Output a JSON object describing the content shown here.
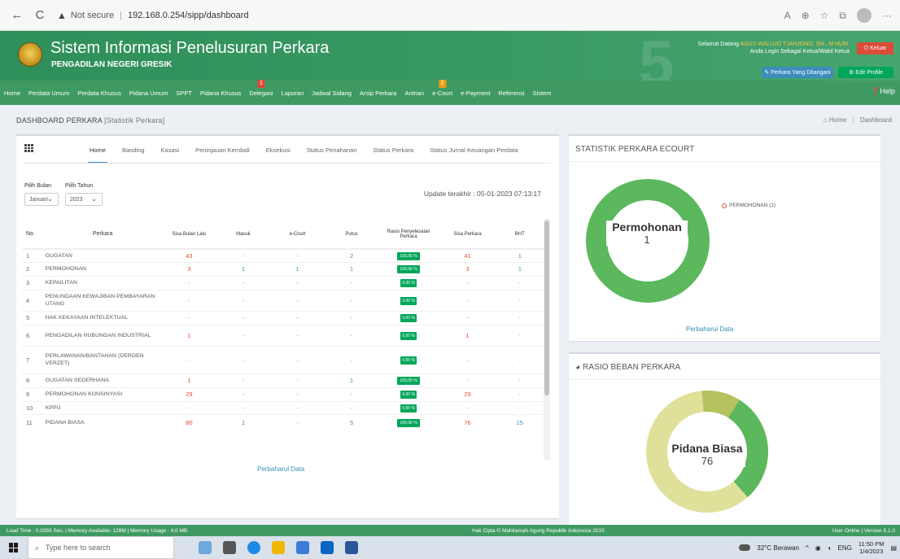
{
  "browser": {
    "back": "←",
    "reload": "C",
    "warning": "▲",
    "not_secure": "Not secure",
    "url": "192.168.0.254/sipp/dashboard"
  },
  "header": {
    "title": "Sistem Informasi Penelusuran Perkara",
    "subtitle": "PENGADILAN NEGERI GRESIK",
    "bg_number": "5",
    "welcome_prefix": "Selamat Datang",
    "welcome_name": "AGUS WALUJO TJAHJONO, SH., M.HUM.",
    "welcome_line2": "Anda Login Sebagai Ketua/Wakil Ketua",
    "keluar": "Keluar",
    "perkara_ditangani": "Perkara Yang Ditangani",
    "edit_profile": "Edit Profile"
  },
  "nav": {
    "items": [
      "Home",
      "Perdata Umum",
      "Perdata Khusus",
      "Pidana Umum",
      "SPPT",
      "Pidana Khusus",
      "Delegasi",
      "Laporan",
      "Jadwal Sidang",
      "Arsip Perkara",
      "Antrian",
      "e-Court",
      "e-Payment",
      "Referensi",
      "Sistem"
    ],
    "delegasi_badge": "1",
    "ecourt_badge": "2",
    "help": "Help"
  },
  "page": {
    "title": "DASHBOARD PERKARA",
    "title_small": "[Statistik Perkara]",
    "breadcrumb_home": "Home",
    "breadcrumb_current": "Dashboard"
  },
  "left_panel": {
    "tabs": [
      "Home",
      "Banding",
      "Kasasi",
      "Peninjauan Kembali",
      "Eksekusi",
      "Status Penahanan",
      "Status Perkara",
      "Status Jurnal Keuangan Perdata"
    ],
    "filter_month_label": "Pilih Bulan",
    "filter_month_value": "Januari",
    "filter_year_label": "Pilih Tahun",
    "filter_year_value": "2023",
    "update_text": "Update terakhir : 05-01-2023 07:13:17",
    "table_headers": {
      "no": "No",
      "perkara": "Perkara",
      "sisa_bulan_lalu": "Sisa Bulan Lalu",
      "masuk": "Masuk",
      "ecourt": "e-Court",
      "putus": "Putus",
      "rasio": "Rasio Penyelesaian Perkara",
      "sisa_perkara": "Sisa Perkara",
      "bht": "BHT"
    },
    "rows": [
      {
        "no": "1",
        "perkara": "GUGATAN",
        "sisa": "43",
        "masuk": "-",
        "ecourt": "-",
        "putus": "2",
        "rasio": "100,00 %",
        "sisa_perkara": "41",
        "bht": "1"
      },
      {
        "no": "2",
        "perkara": "PERMOHONAN",
        "sisa": "3",
        "masuk": "1",
        "ecourt": "1",
        "putus": "1",
        "rasio": "100,00 %",
        "sisa_perkara": "3",
        "bht": "1"
      },
      {
        "no": "3",
        "perkara": "KEPAILITAN",
        "sisa": "-",
        "masuk": "-",
        "ecourt": "-",
        "putus": "-",
        "rasio": "0,00 %",
        "sisa_perkara": "-",
        "bht": "-"
      },
      {
        "no": "4",
        "perkara": "PENUNDAAN KEWAJIBAN PEMBAYARAN UTANG",
        "sisa": "-",
        "masuk": "-",
        "ecourt": "-",
        "putus": "-",
        "rasio": "0,00 %",
        "sisa_perkara": "-",
        "bht": "-"
      },
      {
        "no": "5",
        "perkara": "HAK KEKAYAAN INTELEKTUAL",
        "sisa": "-",
        "masuk": "-",
        "ecourt": "-",
        "putus": "-",
        "rasio": "0,00 %",
        "sisa_perkara": "-",
        "bht": "-"
      },
      {
        "no": "6",
        "perkara": "PENGADILAN HUBUNGAN INDUSTRIAL",
        "sisa": "1",
        "masuk": "-",
        "ecourt": "-",
        "putus": "-",
        "rasio": "0,00 %",
        "sisa_perkara": "1",
        "bht": "-"
      },
      {
        "no": "7",
        "perkara": "PERLAWANAN/BANTAHAN (DERDEN VERZET)",
        "sisa": "-",
        "masuk": "-",
        "ecourt": "-",
        "putus": "-",
        "rasio": "0,00 %",
        "sisa_perkara": "-",
        "bht": "-"
      },
      {
        "no": "8",
        "perkara": "GUGATAN SEDERHANA",
        "sisa": "1",
        "masuk": "-",
        "ecourt": "-",
        "putus": "1",
        "rasio": "100,00 %",
        "sisa_perkara": "-",
        "bht": "-"
      },
      {
        "no": "9",
        "perkara": "PERMOHONAN KONSINYASI",
        "sisa": "29",
        "masuk": "-",
        "ecourt": "-",
        "putus": "-",
        "rasio": "0,00 %",
        "sisa_perkara": "29",
        "bht": "-"
      },
      {
        "no": "10",
        "perkara": "KPPU",
        "sisa": "-",
        "masuk": "-",
        "ecourt": "-",
        "putus": "-",
        "rasio": "0,00 %",
        "sisa_perkara": "-",
        "bht": "-"
      },
      {
        "no": "11",
        "perkara": "PIDANA BIASA",
        "sisa": "80",
        "masuk": "1",
        "ecourt": "-",
        "putus": "5",
        "rasio": "100,00 %",
        "sisa_perkara": "76",
        "bht": "15"
      }
    ],
    "refresh": "Perbaharui Data"
  },
  "ecourt_panel": {
    "title": "STATISTIK PERKARA ECOURT",
    "legend": "PERMOHONAN (1)",
    "center_label": "Permohonan",
    "center_value": "1",
    "refresh": "Perbaharui Data",
    "colors": {
      "ring": "#5cb85c"
    }
  },
  "rasio_panel": {
    "title": "RASIO BEBAN PERKARA",
    "center_label": "Pidana Biasa",
    "center_value": "76",
    "colors": {
      "major": "#dfe09a",
      "minor": "#5cb85c",
      "small": "#b5c25f"
    }
  },
  "footer": {
    "left": "Load Time : 0,0393 Sec. | Memory Available: 128M | Memory Usage : 4,0 MB",
    "mid": "Hak Cipta © Mahkamah Agung Republik Indonesia 2015",
    "right": "User Online | Version 5.1.0"
  },
  "taskbar": {
    "search": "Type here to search",
    "weather": "32°C Berawan",
    "lang": "ENG",
    "time": "11:50 PM",
    "date": "1/4/2023"
  }
}
